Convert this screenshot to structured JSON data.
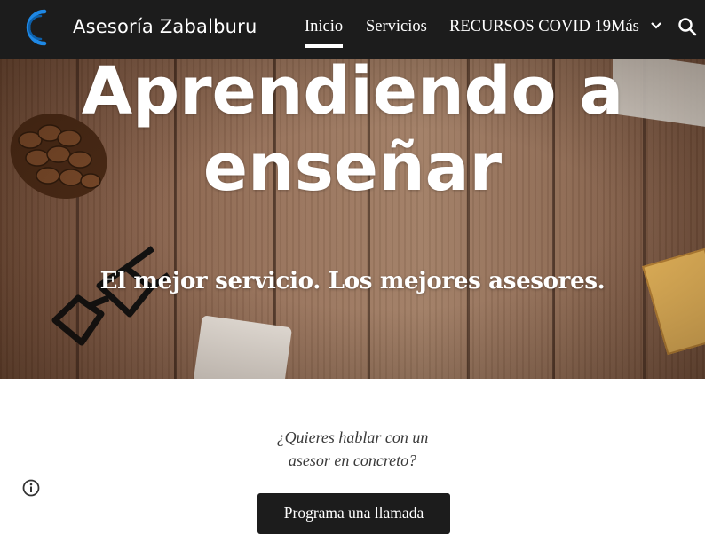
{
  "header": {
    "site_title": "Asesoría Zabalburu",
    "nav": [
      "Inicio",
      "Servicios",
      "RECURSOS COVID 19"
    ],
    "more_label": "Más",
    "active_index": 0,
    "icons": {
      "logo": "circle-logo-icon",
      "search": "search-icon",
      "more": "chevron-down-icon"
    }
  },
  "hero": {
    "title_line1": "Aprendiendo a",
    "title_line2": "enseñar",
    "subtitle": "El mejor servicio. Los mejores asesores."
  },
  "content": {
    "question_line1": "¿Quieres hablar con un",
    "question_line2": "asesor en concreto?",
    "cta_label": "Programa una llamada"
  },
  "footer": {
    "info_icon": "info-icon"
  },
  "colors": {
    "header_bg": "#1c1c1c",
    "accent_blue": "#1e88e5",
    "button_bg": "#1c1c1c"
  }
}
